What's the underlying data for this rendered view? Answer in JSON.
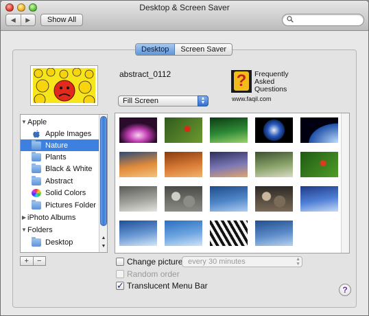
{
  "window": {
    "title": "Desktop & Screen Saver"
  },
  "toolbar": {
    "back_icon": "chevron-left-icon",
    "forward_icon": "chevron-right-icon",
    "show_all_label": "Show All",
    "search_placeholder": "",
    "search_icon": "magnifier-icon"
  },
  "tabs": [
    {
      "label": "Desktop",
      "selected": true
    },
    {
      "label": "Screen Saver",
      "selected": false
    }
  ],
  "current_picture": {
    "name": "abstract_0112"
  },
  "fit_mode": {
    "selected": "Fill Screen"
  },
  "watermark": {
    "line1": "Frequently",
    "line2": "Asked",
    "line3": "Questions",
    "url": "www.faqil.com",
    "icon": "question-mark-logo"
  },
  "sidebar": {
    "items": [
      {
        "label": "Apple",
        "kind": "group",
        "expanded": true,
        "icon": "disclosure-triangle-icon"
      },
      {
        "label": "Apple Images",
        "kind": "item",
        "icon": "apple-logo-icon"
      },
      {
        "label": "Nature",
        "kind": "item",
        "icon": "folder-icon",
        "selected": true
      },
      {
        "label": "Plants",
        "kind": "item",
        "icon": "folder-icon"
      },
      {
        "label": "Black & White",
        "kind": "item",
        "icon": "folder-icon"
      },
      {
        "label": "Abstract",
        "kind": "item",
        "icon": "folder-icon"
      },
      {
        "label": "Solid Colors",
        "kind": "item",
        "icon": "color-wheel-icon"
      },
      {
        "label": "Pictures Folder",
        "kind": "item",
        "icon": "folder-icon"
      },
      {
        "label": "iPhoto Albums",
        "kind": "group",
        "expanded": false,
        "icon": "disclosure-triangle-icon"
      },
      {
        "label": "Folders",
        "kind": "group",
        "expanded": true,
        "icon": "disclosure-triangle-icon"
      },
      {
        "label": "Desktop",
        "kind": "item",
        "icon": "folder-icon"
      }
    ],
    "add_label": "+",
    "remove_label": "−"
  },
  "thumbnails": [
    {
      "subject": "aurora-pink",
      "colors": [
        "#2a0b2a",
        "#c13fb3",
        "#f8d2f0"
      ]
    },
    {
      "subject": "ladybug-moss",
      "colors": [
        "#2f5a1d",
        "#6e9a2f",
        "#d62a12"
      ]
    },
    {
      "subject": "green-leaf-drop",
      "colors": [
        "#0c3b14",
        "#2e8a36",
        "#9bd16b"
      ]
    },
    {
      "subject": "earth",
      "colors": [
        "#000000",
        "#2a5bbd",
        "#e6eef8"
      ]
    },
    {
      "subject": "earth-horizon",
      "colors": [
        "#000010",
        "#1f4fa8",
        "#bfe0ff"
      ]
    },
    {
      "subject": "sunset-clouds",
      "colors": [
        "#2a4b7a",
        "#e18b3a",
        "#f3c37d"
      ]
    },
    {
      "subject": "sand-waves",
      "colors": [
        "#8a3b0f",
        "#d77a35",
        "#f2b36a"
      ]
    },
    {
      "subject": "ocean-dusk",
      "colors": [
        "#2c2f5c",
        "#7d78b6",
        "#e2a66a"
      ]
    },
    {
      "subject": "rice-terraces",
      "colors": [
        "#3c5230",
        "#8aa36a",
        "#d8dcc4"
      ]
    },
    {
      "subject": "ladybug-leaf",
      "colors": [
        "#1f5a12",
        "#4e9c2a",
        "#e0391b"
      ]
    },
    {
      "subject": "zen-garden",
      "colors": [
        "#5a5a58",
        "#a0a29a",
        "#e4e4de"
      ]
    },
    {
      "subject": "pebbles",
      "colors": [
        "#4a4a48",
        "#8c8c86",
        "#cfcfc8"
      ]
    },
    {
      "subject": "blue-water",
      "colors": [
        "#1f4b8a",
        "#4f86c8",
        "#aecdf0"
      ]
    },
    {
      "subject": "stones-pile",
      "colors": [
        "#2e2a26",
        "#7a6a58",
        "#c9b89e"
      ]
    },
    {
      "subject": "blue-haze",
      "colors": [
        "#203a86",
        "#4f7fd6",
        "#c6d9f7"
      ]
    },
    {
      "subject": "water-ripples",
      "colors": [
        "#1e4f9a",
        "#6c9ad4",
        "#d5e6f7"
      ]
    },
    {
      "subject": "calm-sea",
      "colors": [
        "#2a6fc0",
        "#6fa6e0",
        "#cfe3f6"
      ]
    },
    {
      "subject": "zebra-stripes",
      "colors": [
        "#111111",
        "#f2f2f2",
        "#777777"
      ]
    },
    {
      "subject": "water-surface",
      "colors": [
        "#224f8f",
        "#5d8cc8",
        "#b7d2ee"
      ]
    }
  ],
  "options": {
    "change_picture": {
      "label": "Change picture:",
      "checked": false
    },
    "interval": {
      "value": "every 30 minutes",
      "enabled": false
    },
    "random_order": {
      "label": "Random order",
      "checked": false,
      "enabled": false
    },
    "translucent_menu_bar": {
      "label": "Translucent Menu Bar",
      "checked": true
    }
  },
  "help_label": "?",
  "colors": {
    "selection": "#3d80df",
    "accent": "#5c96da"
  }
}
